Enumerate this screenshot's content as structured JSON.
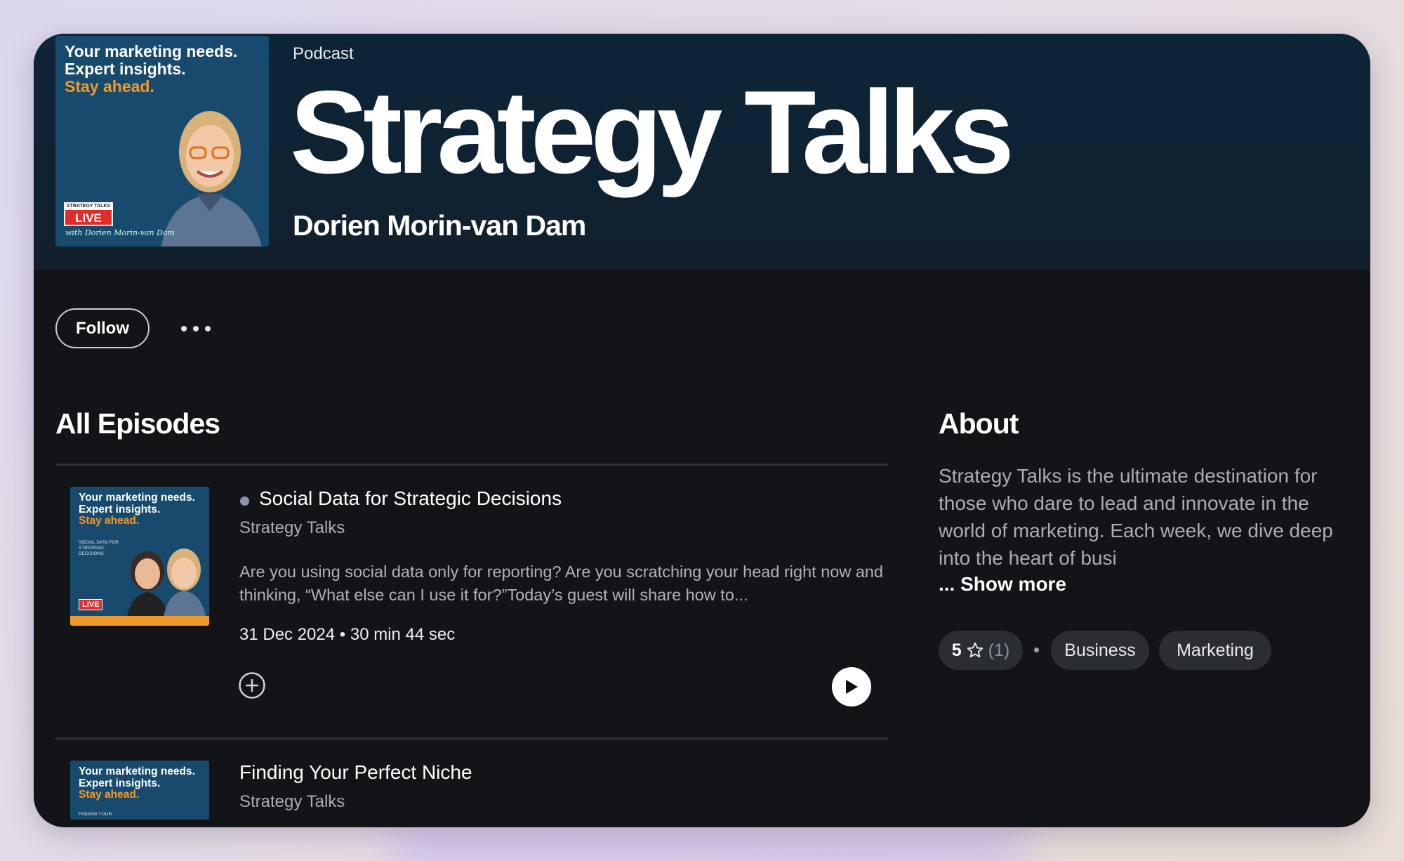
{
  "podcast": {
    "kind": "Podcast",
    "title": "Strategy Talks",
    "author": "Dorien Morin-van Dam",
    "cover": {
      "line1": "Your marketing needs.",
      "line2": "Expert insights.",
      "line3": "Stay ahead.",
      "badge": "LIVE",
      "signature": "with Dorien Morin-van Dam"
    }
  },
  "actions": {
    "follow_label": "Follow"
  },
  "episodes": {
    "heading": "All Episodes",
    "items": [
      {
        "title": "Social Data for Strategic Decisions",
        "show": "Strategy Talks",
        "description": "Are you using social data only for reporting? Are you scratching your head right now and thinking, “What else can I use it for?”Today’s guest will share how to...",
        "meta": "31 Dec 2024 • 30 min 44 sec",
        "cover_small": "SOCIAL DATA FOR STRATEGIC DECISIONS",
        "cover_badge": "LIVE"
      },
      {
        "title": "Finding Your Perfect Niche",
        "show": "Strategy Talks",
        "cover_small": "FINDING YOUR"
      }
    ]
  },
  "about": {
    "heading": "About",
    "text": "Strategy Talks is the ultimate destination for those who dare to lead and innovate in the world of marketing. Each week, we dive deep into the heart of busi",
    "show_more": "... Show more",
    "rating": "5",
    "rating_count": "(1)",
    "tags": [
      "Business",
      "Marketing"
    ]
  },
  "icons": {
    "more": "more-horizontal-icon",
    "add": "plus-circle-icon",
    "play": "play-icon",
    "star": "star-icon"
  }
}
